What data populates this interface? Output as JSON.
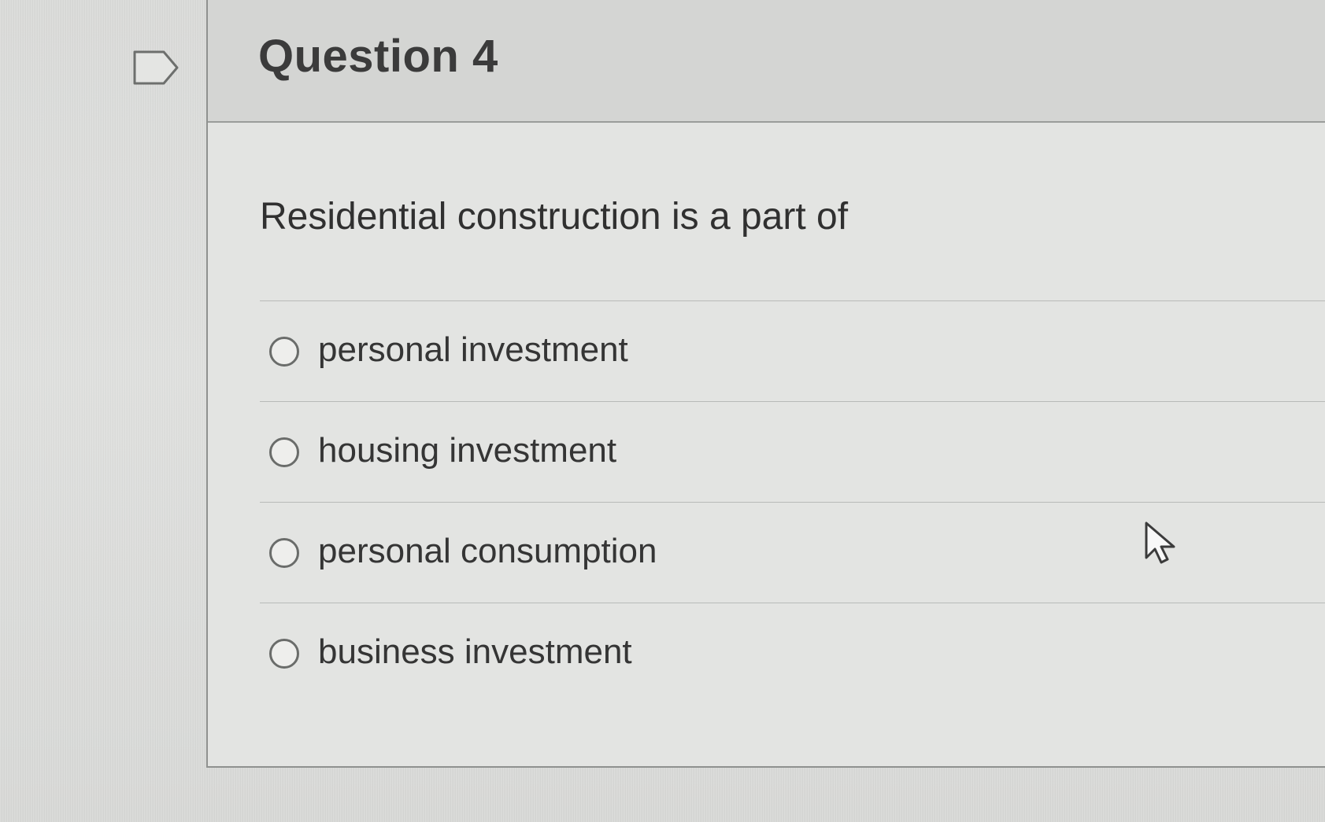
{
  "question": {
    "title": "Question 4",
    "prompt": "Residential construction is a part of",
    "options": [
      {
        "label": "personal investment"
      },
      {
        "label": "housing investment"
      },
      {
        "label": "personal consumption"
      },
      {
        "label": "business investment"
      }
    ]
  },
  "icons": {
    "flag": "flag-question-icon",
    "radio": "radio-button-icon",
    "cursor": "mouse-pointer-icon"
  },
  "colors": {
    "background": "#dedfdd",
    "header": "#d4d5d3",
    "border": "#8f918f",
    "text": "#303030"
  }
}
